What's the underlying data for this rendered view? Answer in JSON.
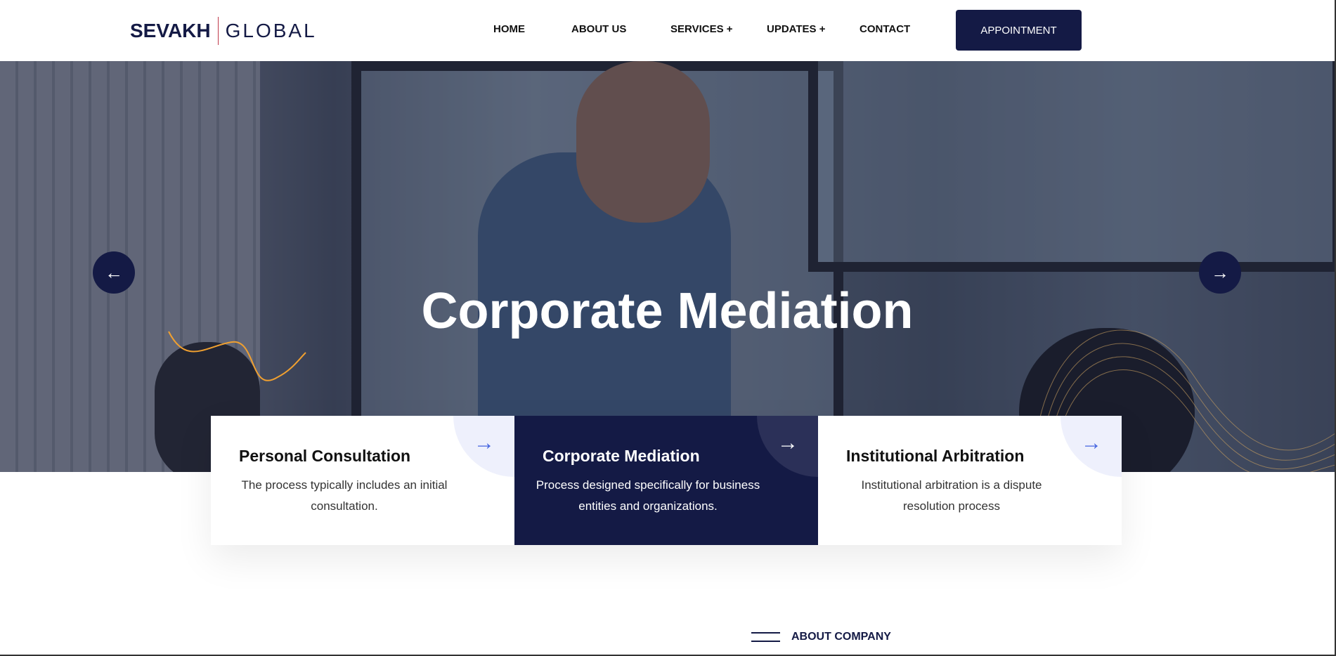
{
  "header": {
    "logo_bold": "SEVAKH",
    "logo_light": "GLOBAL",
    "nav": [
      "HOME",
      "ABOUT US",
      "SERVICES +",
      "UPDATES +",
      "CONTACT"
    ],
    "appointment": "APPOINTMENT"
  },
  "hero": {
    "title": "Corporate Mediation",
    "prev_icon": "←",
    "next_icon": "→"
  },
  "cards": [
    {
      "title": "Personal Consultation",
      "desc": "The process typically includes an initial consultation.",
      "icon": "→"
    },
    {
      "title": "Corporate Mediation",
      "desc": "Process designed specifically for business entities and organizations.",
      "icon": "→"
    },
    {
      "title": "Institutional Arbitration",
      "desc": "Institutional arbitration is a dispute resolution process",
      "icon": "→"
    }
  ],
  "section": {
    "label": "ABOUT COMPANY"
  },
  "colors": {
    "brand": "#141a45",
    "accent": "#4565e0",
    "squiggle": "#f0a030"
  }
}
